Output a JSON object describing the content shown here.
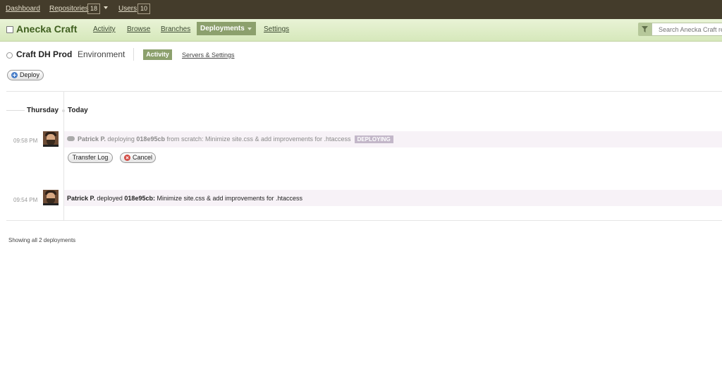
{
  "topbar": {
    "dashboard": "Dashboard",
    "repositories": "Repositories",
    "repositories_count": "18",
    "users": "Users",
    "users_count": "10"
  },
  "repo": {
    "name": "Anecka Craft",
    "nav": {
      "activity": "Activity",
      "browse": "Browse",
      "branches": "Branches",
      "deployments": "Deployments",
      "settings": "Settings"
    },
    "search_placeholder": "Search Anecka Craft re"
  },
  "environment": {
    "name": "Craft DH Prod",
    "type": "Environment",
    "tab_activity": "Activity",
    "tab_servers": "Servers & Settings",
    "deploy_button": "Deploy"
  },
  "timeline": {
    "day": "Thursday",
    "day_relative": "Today",
    "entries": [
      {
        "time": "09:58 PM",
        "user": "Patrick P.",
        "action": " deploying ",
        "commit": "018e95cb",
        "message": " from scratch: Minimize site.css & add improvements for .htaccess",
        "status": "DEPLOYING",
        "transfer_log": "Transfer Log",
        "cancel": "Cancel"
      },
      {
        "time": "09:54 PM",
        "user": "Patrick P.",
        "action": " deployed ",
        "commit": "018e95cb:",
        "message": " Minimize site.css & add improvements for .htaccess"
      }
    ]
  },
  "footer": "Showing all 2 deployments",
  "colors": {
    "topbar": "#443c2b",
    "accent": "#8ca06d",
    "repo_name": "#3f5f1f",
    "deploying_badge": "#c3b7c9",
    "row_highlight": "#f7f2f7"
  }
}
